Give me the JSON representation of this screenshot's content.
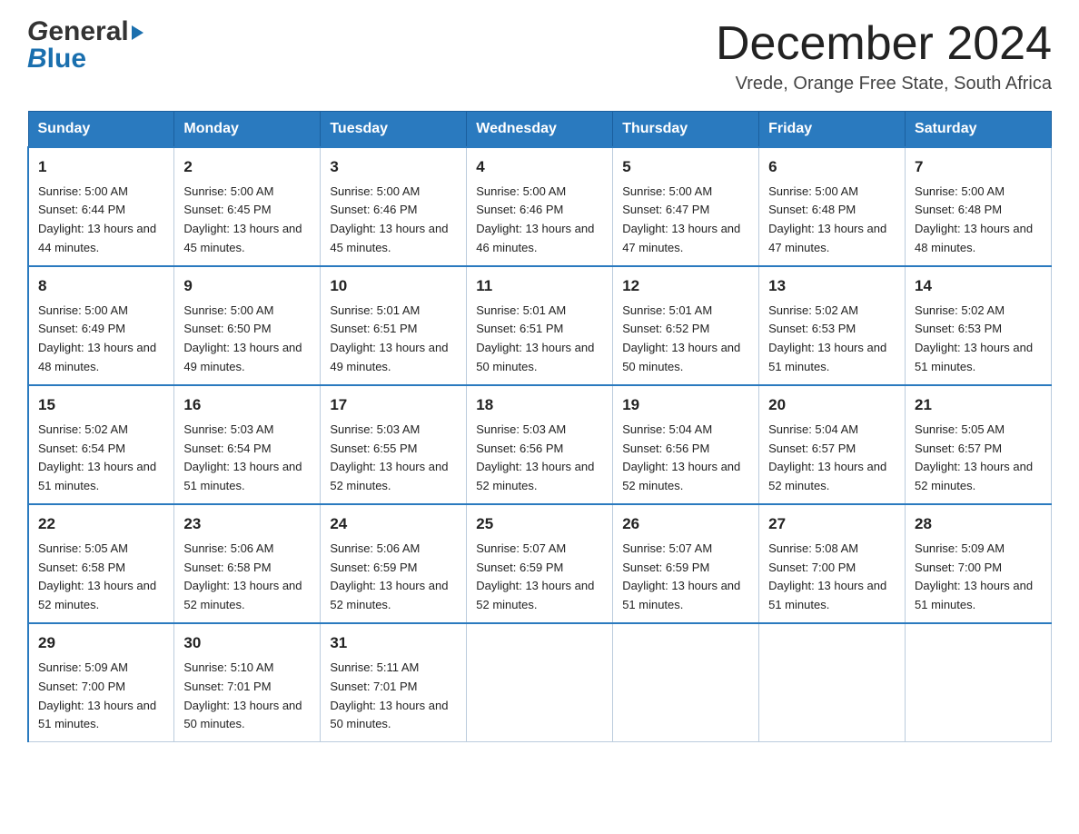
{
  "header": {
    "logo_line1": "General",
    "logo_line2": "Blue",
    "main_title": "December 2024",
    "subtitle": "Vrede, Orange Free State, South Africa"
  },
  "calendar": {
    "days_of_week": [
      "Sunday",
      "Monday",
      "Tuesday",
      "Wednesday",
      "Thursday",
      "Friday",
      "Saturday"
    ],
    "weeks": [
      [
        {
          "day": "1",
          "sunrise": "5:00 AM",
          "sunset": "6:44 PM",
          "daylight": "13 hours and 44 minutes."
        },
        {
          "day": "2",
          "sunrise": "5:00 AM",
          "sunset": "6:45 PM",
          "daylight": "13 hours and 45 minutes."
        },
        {
          "day": "3",
          "sunrise": "5:00 AM",
          "sunset": "6:46 PM",
          "daylight": "13 hours and 45 minutes."
        },
        {
          "day": "4",
          "sunrise": "5:00 AM",
          "sunset": "6:46 PM",
          "daylight": "13 hours and 46 minutes."
        },
        {
          "day": "5",
          "sunrise": "5:00 AM",
          "sunset": "6:47 PM",
          "daylight": "13 hours and 47 minutes."
        },
        {
          "day": "6",
          "sunrise": "5:00 AM",
          "sunset": "6:48 PM",
          "daylight": "13 hours and 47 minutes."
        },
        {
          "day": "7",
          "sunrise": "5:00 AM",
          "sunset": "6:48 PM",
          "daylight": "13 hours and 48 minutes."
        }
      ],
      [
        {
          "day": "8",
          "sunrise": "5:00 AM",
          "sunset": "6:49 PM",
          "daylight": "13 hours and 48 minutes."
        },
        {
          "day": "9",
          "sunrise": "5:00 AM",
          "sunset": "6:50 PM",
          "daylight": "13 hours and 49 minutes."
        },
        {
          "day": "10",
          "sunrise": "5:01 AM",
          "sunset": "6:51 PM",
          "daylight": "13 hours and 49 minutes."
        },
        {
          "day": "11",
          "sunrise": "5:01 AM",
          "sunset": "6:51 PM",
          "daylight": "13 hours and 50 minutes."
        },
        {
          "day": "12",
          "sunrise": "5:01 AM",
          "sunset": "6:52 PM",
          "daylight": "13 hours and 50 minutes."
        },
        {
          "day": "13",
          "sunrise": "5:02 AM",
          "sunset": "6:53 PM",
          "daylight": "13 hours and 51 minutes."
        },
        {
          "day": "14",
          "sunrise": "5:02 AM",
          "sunset": "6:53 PM",
          "daylight": "13 hours and 51 minutes."
        }
      ],
      [
        {
          "day": "15",
          "sunrise": "5:02 AM",
          "sunset": "6:54 PM",
          "daylight": "13 hours and 51 minutes."
        },
        {
          "day": "16",
          "sunrise": "5:03 AM",
          "sunset": "6:54 PM",
          "daylight": "13 hours and 51 minutes."
        },
        {
          "day": "17",
          "sunrise": "5:03 AM",
          "sunset": "6:55 PM",
          "daylight": "13 hours and 52 minutes."
        },
        {
          "day": "18",
          "sunrise": "5:03 AM",
          "sunset": "6:56 PM",
          "daylight": "13 hours and 52 minutes."
        },
        {
          "day": "19",
          "sunrise": "5:04 AM",
          "sunset": "6:56 PM",
          "daylight": "13 hours and 52 minutes."
        },
        {
          "day": "20",
          "sunrise": "5:04 AM",
          "sunset": "6:57 PM",
          "daylight": "13 hours and 52 minutes."
        },
        {
          "day": "21",
          "sunrise": "5:05 AM",
          "sunset": "6:57 PM",
          "daylight": "13 hours and 52 minutes."
        }
      ],
      [
        {
          "day": "22",
          "sunrise": "5:05 AM",
          "sunset": "6:58 PM",
          "daylight": "13 hours and 52 minutes."
        },
        {
          "day": "23",
          "sunrise": "5:06 AM",
          "sunset": "6:58 PM",
          "daylight": "13 hours and 52 minutes."
        },
        {
          "day": "24",
          "sunrise": "5:06 AM",
          "sunset": "6:59 PM",
          "daylight": "13 hours and 52 minutes."
        },
        {
          "day": "25",
          "sunrise": "5:07 AM",
          "sunset": "6:59 PM",
          "daylight": "13 hours and 52 minutes."
        },
        {
          "day": "26",
          "sunrise": "5:07 AM",
          "sunset": "6:59 PM",
          "daylight": "13 hours and 51 minutes."
        },
        {
          "day": "27",
          "sunrise": "5:08 AM",
          "sunset": "7:00 PM",
          "daylight": "13 hours and 51 minutes."
        },
        {
          "day": "28",
          "sunrise": "5:09 AM",
          "sunset": "7:00 PM",
          "daylight": "13 hours and 51 minutes."
        }
      ],
      [
        {
          "day": "29",
          "sunrise": "5:09 AM",
          "sunset": "7:00 PM",
          "daylight": "13 hours and 51 minutes."
        },
        {
          "day": "30",
          "sunrise": "5:10 AM",
          "sunset": "7:01 PM",
          "daylight": "13 hours and 50 minutes."
        },
        {
          "day": "31",
          "sunrise": "5:11 AM",
          "sunset": "7:01 PM",
          "daylight": "13 hours and 50 minutes."
        },
        null,
        null,
        null,
        null
      ]
    ]
  }
}
